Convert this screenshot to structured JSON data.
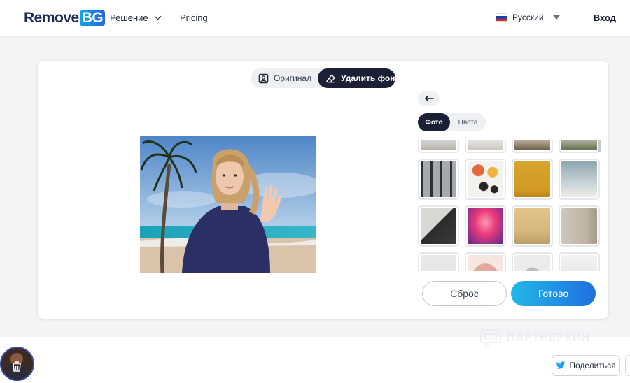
{
  "header": {
    "logo_remove": "Remove",
    "logo_bg": "BG",
    "nav": [
      {
        "label": "Решение"
      },
      {
        "label": "Pricing"
      }
    ],
    "language": "Русский",
    "login": "Вход"
  },
  "toggle": {
    "original_label": "Оригинал",
    "remove_label": "Удалить фон"
  },
  "tabs": {
    "photo": "Фото",
    "colors": "Цвета"
  },
  "buttons": {
    "reset": "Сброс",
    "done": "Готово"
  },
  "footer": {
    "share_label": "Поделиться",
    "watermark": "ПАРТНЕРКИН"
  },
  "colors": {
    "accent_dark": "#1a2035",
    "done_gradient_start": "#22b8e8",
    "done_gradient_end": "#1f6fe0"
  },
  "thumbnails": [
    {
      "name": "white-interior-1"
    },
    {
      "name": "white-interior-2"
    },
    {
      "name": "room-with-chairs"
    },
    {
      "name": "plant-interior"
    },
    {
      "name": "glass-office"
    },
    {
      "name": "flatlay-flowers-coffee"
    },
    {
      "name": "mustard-wall-stool"
    },
    {
      "name": "sky-clouds"
    },
    {
      "name": "gallery-staircase"
    },
    {
      "name": "neon-corridor"
    },
    {
      "name": "yellow-room-chair"
    },
    {
      "name": "beige-wall-plants"
    },
    {
      "name": "white-room-3"
    },
    {
      "name": "pink-circle"
    },
    {
      "name": "grey-lamp"
    },
    {
      "name": "white-shelf"
    }
  ]
}
